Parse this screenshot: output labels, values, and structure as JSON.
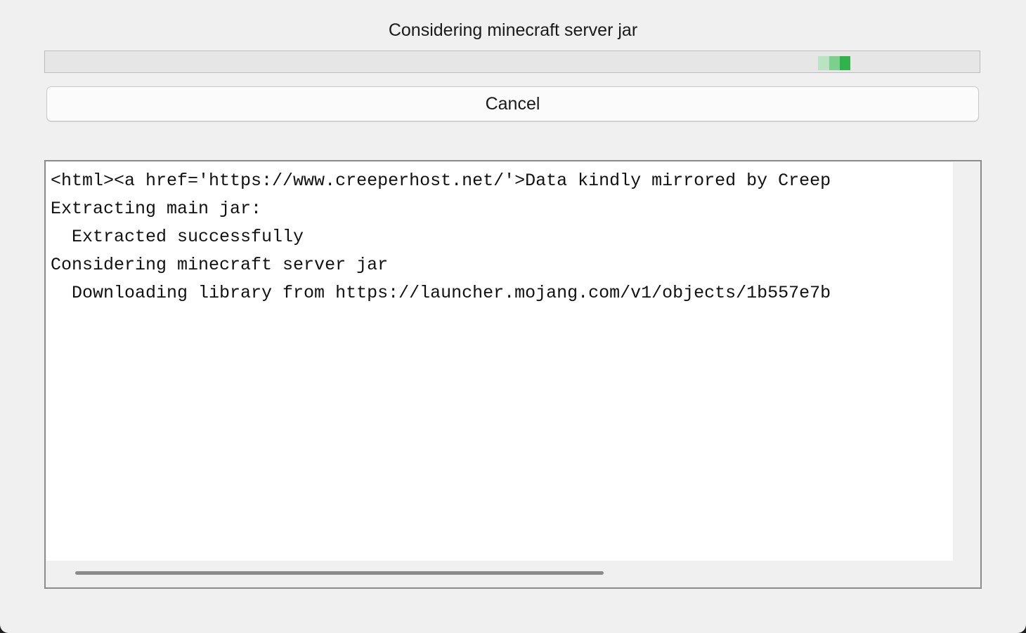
{
  "status": {
    "title": "Considering minecraft server jar"
  },
  "progress": {
    "mode": "indeterminate",
    "colors": [
      "#b9e3c2",
      "#7ccf8d",
      "#2fb34a"
    ]
  },
  "actions": {
    "cancel_label": "Cancel"
  },
  "log": {
    "lines": [
      "<html><a href='https://www.creeperhost.net/'>Data kindly mirrored by Creep",
      "Extracting main jar:",
      "  Extracted successfully",
      "Considering minecraft server jar",
      "  Downloading library from https://launcher.mojang.com/v1/objects/1b557e7b"
    ]
  }
}
